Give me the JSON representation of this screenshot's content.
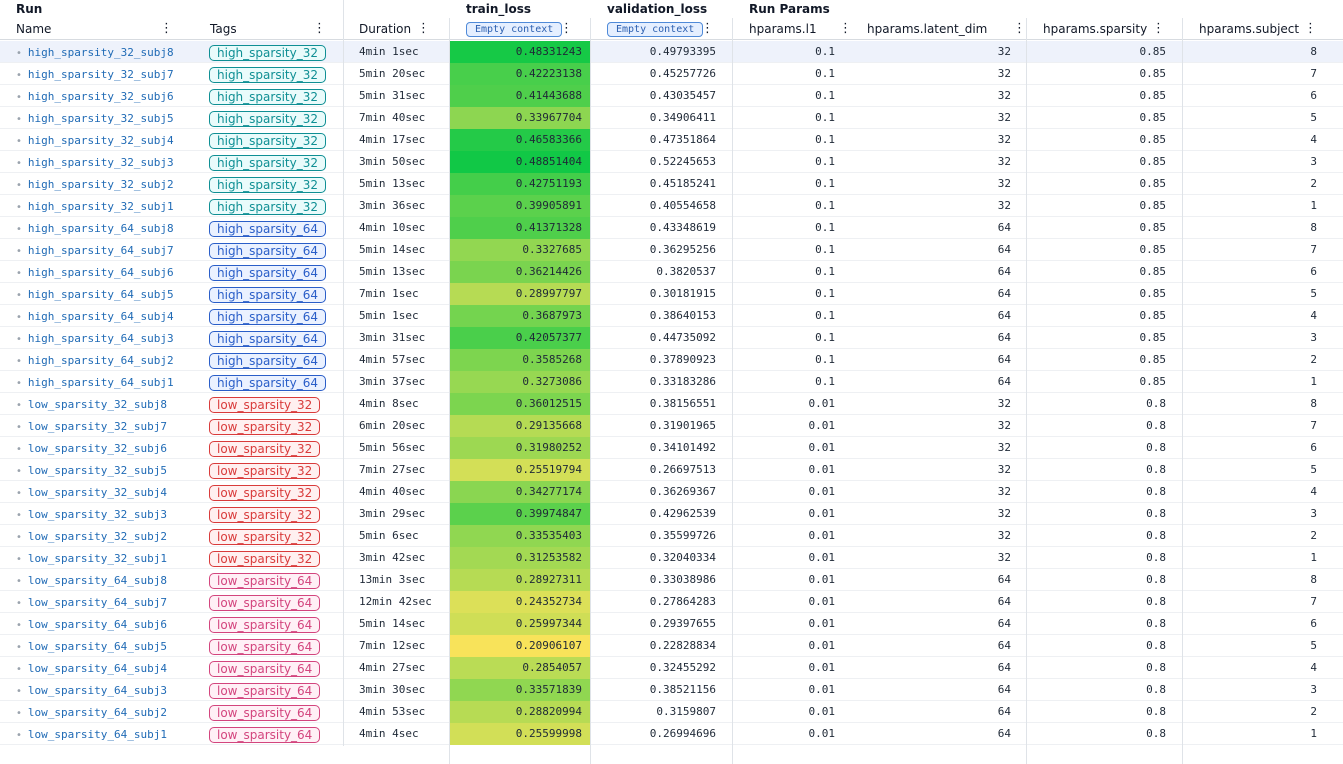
{
  "groups": {
    "run": "Run",
    "train_loss": "train_loss",
    "validation_loss": "validation_loss",
    "run_params": "Run Params"
  },
  "headers": {
    "name": "Name",
    "tags": "Tags",
    "duration": "Duration",
    "train_loss": "Empty context",
    "validation_loss": "Empty context",
    "l1": "hparams.l1",
    "latent_dim": "hparams.latent_dim",
    "sparsity": "hparams.sparsity",
    "subject": "hparams.subject"
  },
  "colors": {
    "tag_high32": "#0f8f94",
    "tag_high64": "#2a5ec8",
    "tag_low32": "#d93b3b",
    "tag_low64": "#d3457e",
    "selected_row": "#eef2fb",
    "heat_low": "#f8e35a",
    "heat_high": "#10c846"
  },
  "rows": [
    {
      "name": "high_sparsity_32_subj8",
      "tag": "high_sparsity_32",
      "tag_color": "#0f8f94",
      "duration": "4min 1sec",
      "train_loss": "0.48331243",
      "validation_loss": "0.49793395",
      "l1": "0.1",
      "latent_dim": "32",
      "sparsity": "0.85",
      "subject": "8"
    },
    {
      "name": "high_sparsity_32_subj7",
      "tag": "high_sparsity_32",
      "tag_color": "#0f8f94",
      "duration": "5min 20sec",
      "train_loss": "0.42223138",
      "validation_loss": "0.45257726",
      "l1": "0.1",
      "latent_dim": "32",
      "sparsity": "0.85",
      "subject": "7"
    },
    {
      "name": "high_sparsity_32_subj6",
      "tag": "high_sparsity_32",
      "tag_color": "#0f8f94",
      "duration": "5min 31sec",
      "train_loss": "0.41443688",
      "validation_loss": "0.43035457",
      "l1": "0.1",
      "latent_dim": "32",
      "sparsity": "0.85",
      "subject": "6"
    },
    {
      "name": "high_sparsity_32_subj5",
      "tag": "high_sparsity_32",
      "tag_color": "#0f8f94",
      "duration": "7min 40sec",
      "train_loss": "0.33967704",
      "validation_loss": "0.34906411",
      "l1": "0.1",
      "latent_dim": "32",
      "sparsity": "0.85",
      "subject": "5"
    },
    {
      "name": "high_sparsity_32_subj4",
      "tag": "high_sparsity_32",
      "tag_color": "#0f8f94",
      "duration": "4min 17sec",
      "train_loss": "0.46583366",
      "validation_loss": "0.47351864",
      "l1": "0.1",
      "latent_dim": "32",
      "sparsity": "0.85",
      "subject": "4"
    },
    {
      "name": "high_sparsity_32_subj3",
      "tag": "high_sparsity_32",
      "tag_color": "#0f8f94",
      "duration": "3min 50sec",
      "train_loss": "0.48851404",
      "validation_loss": "0.52245653",
      "l1": "0.1",
      "latent_dim": "32",
      "sparsity": "0.85",
      "subject": "3"
    },
    {
      "name": "high_sparsity_32_subj2",
      "tag": "high_sparsity_32",
      "tag_color": "#0f8f94",
      "duration": "5min 13sec",
      "train_loss": "0.42751193",
      "validation_loss": "0.45185241",
      "l1": "0.1",
      "latent_dim": "32",
      "sparsity": "0.85",
      "subject": "2"
    },
    {
      "name": "high_sparsity_32_subj1",
      "tag": "high_sparsity_32",
      "tag_color": "#0f8f94",
      "duration": "3min 36sec",
      "train_loss": "0.39905891",
      "validation_loss": "0.40554658",
      "l1": "0.1",
      "latent_dim": "32",
      "sparsity": "0.85",
      "subject": "1"
    },
    {
      "name": "high_sparsity_64_subj8",
      "tag": "high_sparsity_64",
      "tag_color": "#2a5ec8",
      "duration": "4min 10sec",
      "train_loss": "0.41371328",
      "validation_loss": "0.43348619",
      "l1": "0.1",
      "latent_dim": "64",
      "sparsity": "0.85",
      "subject": "8"
    },
    {
      "name": "high_sparsity_64_subj7",
      "tag": "high_sparsity_64",
      "tag_color": "#2a5ec8",
      "duration": "5min 14sec",
      "train_loss": "0.3327685",
      "validation_loss": "0.36295256",
      "l1": "0.1",
      "latent_dim": "64",
      "sparsity": "0.85",
      "subject": "7"
    },
    {
      "name": "high_sparsity_64_subj6",
      "tag": "high_sparsity_64",
      "tag_color": "#2a5ec8",
      "duration": "5min 13sec",
      "train_loss": "0.36214426",
      "validation_loss": "0.3820537",
      "l1": "0.1",
      "latent_dim": "64",
      "sparsity": "0.85",
      "subject": "6"
    },
    {
      "name": "high_sparsity_64_subj5",
      "tag": "high_sparsity_64",
      "tag_color": "#2a5ec8",
      "duration": "7min 1sec",
      "train_loss": "0.28997797",
      "validation_loss": "0.30181915",
      "l1": "0.1",
      "latent_dim": "64",
      "sparsity": "0.85",
      "subject": "5"
    },
    {
      "name": "high_sparsity_64_subj4",
      "tag": "high_sparsity_64",
      "tag_color": "#2a5ec8",
      "duration": "5min 1sec",
      "train_loss": "0.3687973",
      "validation_loss": "0.38640153",
      "l1": "0.1",
      "latent_dim": "64",
      "sparsity": "0.85",
      "subject": "4"
    },
    {
      "name": "high_sparsity_64_subj3",
      "tag": "high_sparsity_64",
      "tag_color": "#2a5ec8",
      "duration": "3min 31sec",
      "train_loss": "0.42057377",
      "validation_loss": "0.44735092",
      "l1": "0.1",
      "latent_dim": "64",
      "sparsity": "0.85",
      "subject": "3"
    },
    {
      "name": "high_sparsity_64_subj2",
      "tag": "high_sparsity_64",
      "tag_color": "#2a5ec8",
      "duration": "4min 57sec",
      "train_loss": "0.3585268",
      "validation_loss": "0.37890923",
      "l1": "0.1",
      "latent_dim": "64",
      "sparsity": "0.85",
      "subject": "2"
    },
    {
      "name": "high_sparsity_64_subj1",
      "tag": "high_sparsity_64",
      "tag_color": "#2a5ec8",
      "duration": "3min 37sec",
      "train_loss": "0.3273086",
      "validation_loss": "0.33183286",
      "l1": "0.1",
      "latent_dim": "64",
      "sparsity": "0.85",
      "subject": "1"
    },
    {
      "name": "low_sparsity_32_subj8",
      "tag": "low_sparsity_32",
      "tag_color": "#d93b3b",
      "duration": "4min 8sec",
      "train_loss": "0.36012515",
      "validation_loss": "0.38156551",
      "l1": "0.01",
      "latent_dim": "32",
      "sparsity": "0.8",
      "subject": "8"
    },
    {
      "name": "low_sparsity_32_subj7",
      "tag": "low_sparsity_32",
      "tag_color": "#d93b3b",
      "duration": "6min 20sec",
      "train_loss": "0.29135668",
      "validation_loss": "0.31901965",
      "l1": "0.01",
      "latent_dim": "32",
      "sparsity": "0.8",
      "subject": "7"
    },
    {
      "name": "low_sparsity_32_subj6",
      "tag": "low_sparsity_32",
      "tag_color": "#d93b3b",
      "duration": "5min 56sec",
      "train_loss": "0.31980252",
      "validation_loss": "0.34101492",
      "l1": "0.01",
      "latent_dim": "32",
      "sparsity": "0.8",
      "subject": "6"
    },
    {
      "name": "low_sparsity_32_subj5",
      "tag": "low_sparsity_32",
      "tag_color": "#d93b3b",
      "duration": "7min 27sec",
      "train_loss": "0.25519794",
      "validation_loss": "0.26697513",
      "l1": "0.01",
      "latent_dim": "32",
      "sparsity": "0.8",
      "subject": "5"
    },
    {
      "name": "low_sparsity_32_subj4",
      "tag": "low_sparsity_32",
      "tag_color": "#d93b3b",
      "duration": "4min 40sec",
      "train_loss": "0.34277174",
      "validation_loss": "0.36269367",
      "l1": "0.01",
      "latent_dim": "32",
      "sparsity": "0.8",
      "subject": "4"
    },
    {
      "name": "low_sparsity_32_subj3",
      "tag": "low_sparsity_32",
      "tag_color": "#d93b3b",
      "duration": "3min 29sec",
      "train_loss": "0.39974847",
      "validation_loss": "0.42962539",
      "l1": "0.01",
      "latent_dim": "32",
      "sparsity": "0.8",
      "subject": "3"
    },
    {
      "name": "low_sparsity_32_subj2",
      "tag": "low_sparsity_32",
      "tag_color": "#d93b3b",
      "duration": "5min 6sec",
      "train_loss": "0.33535403",
      "validation_loss": "0.35599726",
      "l1": "0.01",
      "latent_dim": "32",
      "sparsity": "0.8",
      "subject": "2"
    },
    {
      "name": "low_sparsity_32_subj1",
      "tag": "low_sparsity_32",
      "tag_color": "#d93b3b",
      "duration": "3min 42sec",
      "train_loss": "0.31253582",
      "validation_loss": "0.32040334",
      "l1": "0.01",
      "latent_dim": "32",
      "sparsity": "0.8",
      "subject": "1"
    },
    {
      "name": "low_sparsity_64_subj8",
      "tag": "low_sparsity_64",
      "tag_color": "#d3457e",
      "duration": "13min 3sec",
      "train_loss": "0.28927311",
      "validation_loss": "0.33038986",
      "l1": "0.01",
      "latent_dim": "64",
      "sparsity": "0.8",
      "subject": "8"
    },
    {
      "name": "low_sparsity_64_subj7",
      "tag": "low_sparsity_64",
      "tag_color": "#d3457e",
      "duration": "12min 42sec",
      "train_loss": "0.24352734",
      "validation_loss": "0.27864283",
      "l1": "0.01",
      "latent_dim": "64",
      "sparsity": "0.8",
      "subject": "7"
    },
    {
      "name": "low_sparsity_64_subj6",
      "tag": "low_sparsity_64",
      "tag_color": "#d3457e",
      "duration": "5min 14sec",
      "train_loss": "0.25997344",
      "validation_loss": "0.29397655",
      "l1": "0.01",
      "latent_dim": "64",
      "sparsity": "0.8",
      "subject": "6"
    },
    {
      "name": "low_sparsity_64_subj5",
      "tag": "low_sparsity_64",
      "tag_color": "#d3457e",
      "duration": "7min 12sec",
      "train_loss": "0.20906107",
      "validation_loss": "0.22828834",
      "l1": "0.01",
      "latent_dim": "64",
      "sparsity": "0.8",
      "subject": "5"
    },
    {
      "name": "low_sparsity_64_subj4",
      "tag": "low_sparsity_64",
      "tag_color": "#d3457e",
      "duration": "4min 27sec",
      "train_loss": "0.2854057",
      "validation_loss": "0.32455292",
      "l1": "0.01",
      "latent_dim": "64",
      "sparsity": "0.8",
      "subject": "4"
    },
    {
      "name": "low_sparsity_64_subj3",
      "tag": "low_sparsity_64",
      "tag_color": "#d3457e",
      "duration": "3min 30sec",
      "train_loss": "0.33571839",
      "validation_loss": "0.38521156",
      "l1": "0.01",
      "latent_dim": "64",
      "sparsity": "0.8",
      "subject": "3"
    },
    {
      "name": "low_sparsity_64_subj2",
      "tag": "low_sparsity_64",
      "tag_color": "#d3457e",
      "duration": "4min 53sec",
      "train_loss": "0.28820994",
      "validation_loss": "0.3159807",
      "l1": "0.01",
      "latent_dim": "64",
      "sparsity": "0.8",
      "subject": "2"
    },
    {
      "name": "low_sparsity_64_subj1",
      "tag": "low_sparsity_64",
      "tag_color": "#d3457e",
      "duration": "4min 4sec",
      "train_loss": "0.25599998",
      "validation_loss": "0.26994696",
      "l1": "0.01",
      "latent_dim": "64",
      "sparsity": "0.8",
      "subject": "1"
    }
  ]
}
